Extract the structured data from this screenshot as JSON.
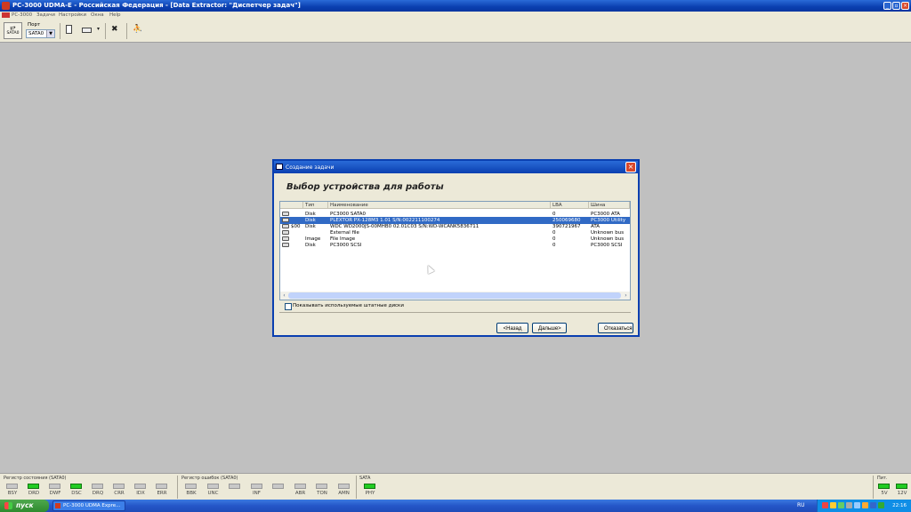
{
  "window": {
    "title": "PC-3000 UDMA-E - Российская Федерация - [Data Extractor: \"Диспетчер задач\"]",
    "controls": {
      "minimize": "_",
      "restore": "▫",
      "close": "×"
    }
  },
  "menu": [
    "PC-3000",
    "Задачи",
    "Настройки",
    "Окна",
    "Help"
  ],
  "toolbar": {
    "sata_label": "SATA0",
    "port_label": "Порт",
    "port_value": "SATA0"
  },
  "dialog": {
    "title": "Создание задачи",
    "heading": "Выбор устройства для работы",
    "columns": [
      "Тип",
      "Наименование",
      "LBA",
      "Шина"
    ],
    "rows": [
      {
        "prefix": "",
        "type": "Disk",
        "name": "PC3000 SATA0",
        "lba": "0",
        "bus": "PC3000 ATA",
        "selected": false
      },
      {
        "prefix": "",
        "type": "Disk",
        "name": "PLEXTOR PX-128M3 1.01 S/N:002211100274",
        "lba": "250069680",
        "bus": "PC3000 Utility",
        "selected": true
      },
      {
        "prefix": "$00",
        "type": "Disk",
        "name": "WDC WD2000JS-00MHB0 02.01C03 S/N:WD-WCANK5836711",
        "lba": "390721967",
        "bus": "ATA",
        "selected": false
      },
      {
        "prefix": "",
        "type": "",
        "name": "External file",
        "lba": "0",
        "bus": "Unknown bus",
        "selected": false
      },
      {
        "prefix": "",
        "type": "Image",
        "name": "File Image",
        "lba": "0",
        "bus": "Unknown bus",
        "selected": false
      },
      {
        "prefix": "",
        "type": "Disk",
        "name": "PC3000 SCSI",
        "lba": "0",
        "bus": "PC3000 SCSI",
        "selected": false
      }
    ],
    "show_used_label": "Показывать используемые штатные диски",
    "buttons": {
      "back": "<Назад",
      "next": "Дальше>",
      "cancel": "Отказаться"
    }
  },
  "status": {
    "state_title": "Регистр состояния (SATA0)",
    "state_leds": [
      {
        "label": "BSY",
        "on": false
      },
      {
        "label": "DRD",
        "on": true
      },
      {
        "label": "DWF",
        "on": false
      },
      {
        "label": "DSC",
        "on": true
      },
      {
        "label": "DRQ",
        "on": false
      },
      {
        "label": "CRR",
        "on": false
      },
      {
        "label": "IDX",
        "on": false
      },
      {
        "label": "ERR",
        "on": false
      }
    ],
    "error_title": "Регистр ошибок (SATA0)",
    "error_leds": [
      {
        "label": "BBK",
        "on": false
      },
      {
        "label": "UNC",
        "on": false
      },
      {
        "label": "",
        "on": false
      },
      {
        "label": "INF",
        "on": false
      },
      {
        "label": "",
        "on": false
      },
      {
        "label": "ABR",
        "on": false
      },
      {
        "label": "TON",
        "on": false
      },
      {
        "label": "AMN",
        "on": false
      }
    ],
    "sata_title": "SATA",
    "sata_leds": [
      {
        "label": "PHY",
        "on": true
      }
    ],
    "power_title": "Пит.",
    "power_leds": [
      {
        "label": "5V",
        "on": true
      },
      {
        "label": "12V",
        "on": true
      }
    ]
  },
  "taskbar": {
    "start": "пуск",
    "task": "PC-3000 UDMA Expre...",
    "lang": "RU",
    "clock": "22:16"
  },
  "colors": {
    "selection": "#316ac5",
    "led_on": "#22cc22",
    "title_blue": "#0a3fb0"
  }
}
